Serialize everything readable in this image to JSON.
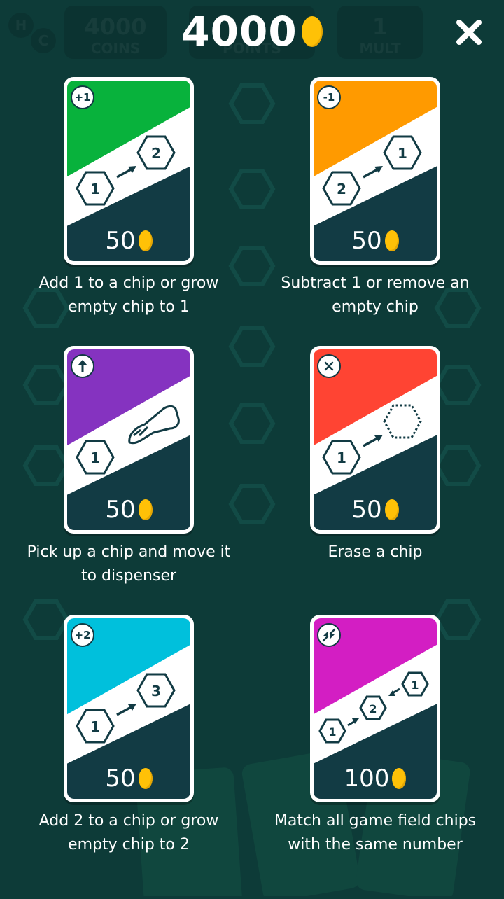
{
  "background_hud": {
    "coins_value": "4000",
    "coins_label": "COINS",
    "points_label": "POINTS",
    "mult_value": "1",
    "mult_label": "MULT",
    "h_label": "H",
    "c_label": "C"
  },
  "header": {
    "balance": "4000",
    "close_icon": "close-icon"
  },
  "cards": [
    {
      "badge": "+1",
      "color": "#08b23c",
      "price": "50",
      "chip_from": "1",
      "chip_to": "2",
      "description_line1": "Add 1 to a chip or grow",
      "description_line2": "empty chip to 1"
    },
    {
      "badge": "-1",
      "color": "#ff9a00",
      "price": "50",
      "chip_from": "2",
      "chip_to": "1",
      "description_line1": "Subtract 1 or remove an",
      "description_line2": "empty chip"
    },
    {
      "badge_icon": "arrow-up-icon",
      "color": "#8533c0",
      "price": "50",
      "chip_from": "1",
      "description_line1": "Pick up a chip and move it",
      "description_line2": "to dispenser"
    },
    {
      "badge_icon": "cross-icon",
      "color": "#ff4433",
      "price": "50",
      "chip_from": "1",
      "description_line1": "Erase a chip",
      "description_line2": ""
    },
    {
      "badge": "+2",
      "color": "#00c0dc",
      "price": "50",
      "chip_from": "1",
      "chip_to": "3",
      "description_line1": "Add 2 to a chip or grow",
      "description_line2": "empty chip to 2"
    },
    {
      "badge_icon": "merge-icon",
      "color": "#d31ec3",
      "price": "100",
      "chip_a": "1",
      "chip_b": "2",
      "chip_c": "1",
      "description_line1": "Match all game field chips",
      "description_line2": "with the same number"
    }
  ],
  "colors": {
    "background": "#0d3b38",
    "card_dark": "#123b44",
    "coin": "#ffc107"
  }
}
